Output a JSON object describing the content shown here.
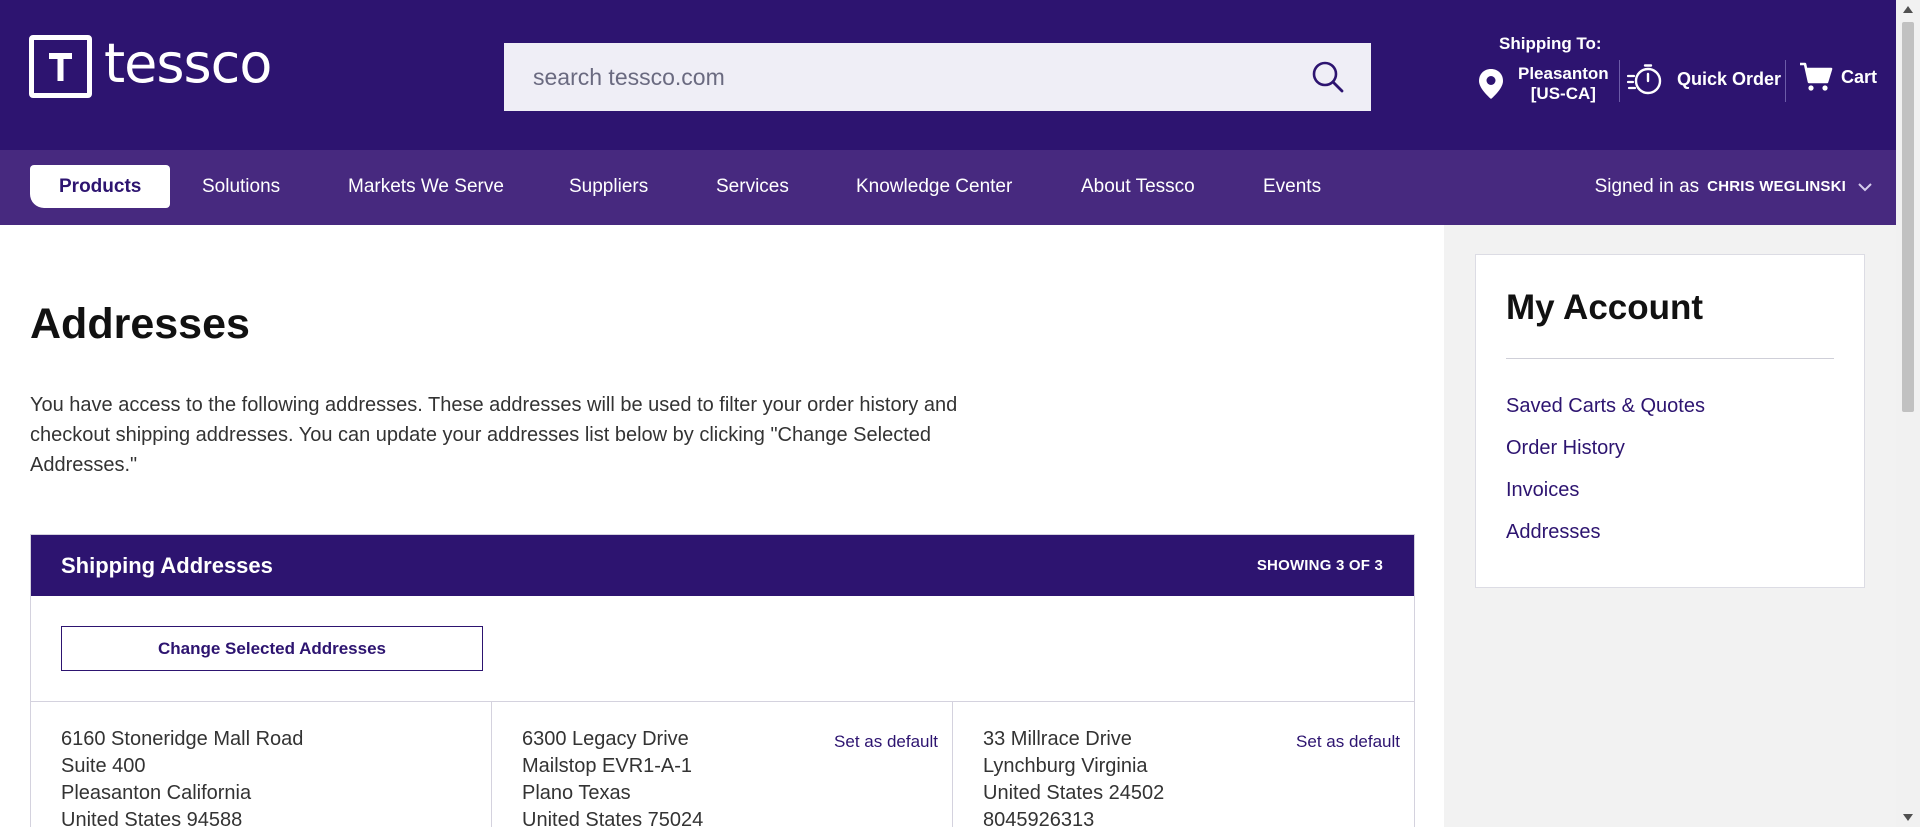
{
  "header": {
    "logo_text": "tessco",
    "search_placeholder": "search tessco.com",
    "shipping_label": "Shipping To:",
    "shipping_city": "Pleasanton",
    "shipping_region": "[US-CA]",
    "quick_order": "Quick Order",
    "cart": "Cart"
  },
  "nav": {
    "items": [
      "Products",
      "Solutions",
      "Markets We Serve",
      "Suppliers",
      "Services",
      "Knowledge Center",
      "About Tessco",
      "Events"
    ],
    "active": "Products",
    "signed_in_label": "Signed in as",
    "user_name": "CHRIS WEGLINSKI"
  },
  "main": {
    "title": "Addresses",
    "intro": "You have access to the following addresses. These addresses will be used to filter your order history and checkout shipping addresses. You can update your addresses list below by clicking \"Change Selected Addresses.\"",
    "panel_title": "Shipping Addresses",
    "panel_count": "SHOWING 3 OF 3",
    "change_button": "Change Selected Addresses",
    "set_default_label": "Set as default",
    "addresses": [
      {
        "lines": [
          "6160 Stoneridge Mall Road",
          "Suite 400",
          "Pleasanton California",
          "United States 94588"
        ]
      },
      {
        "lines": [
          "6300 Legacy Drive",
          "Mailstop EVR1-A-1",
          "Plano Texas",
          "United States 75024"
        ]
      },
      {
        "lines": [
          "33 Millrace Drive",
          "Lynchburg Virginia",
          "United States 24502",
          "8045926313"
        ]
      }
    ]
  },
  "sidebar": {
    "title": "My Account",
    "links": [
      "Saved Carts & Quotes",
      "Order History",
      "Invoices",
      "Addresses"
    ]
  },
  "colors": {
    "brand": "#2d1470",
    "nav": "#47297f",
    "sidebar_bg": "#f2f2f2"
  }
}
